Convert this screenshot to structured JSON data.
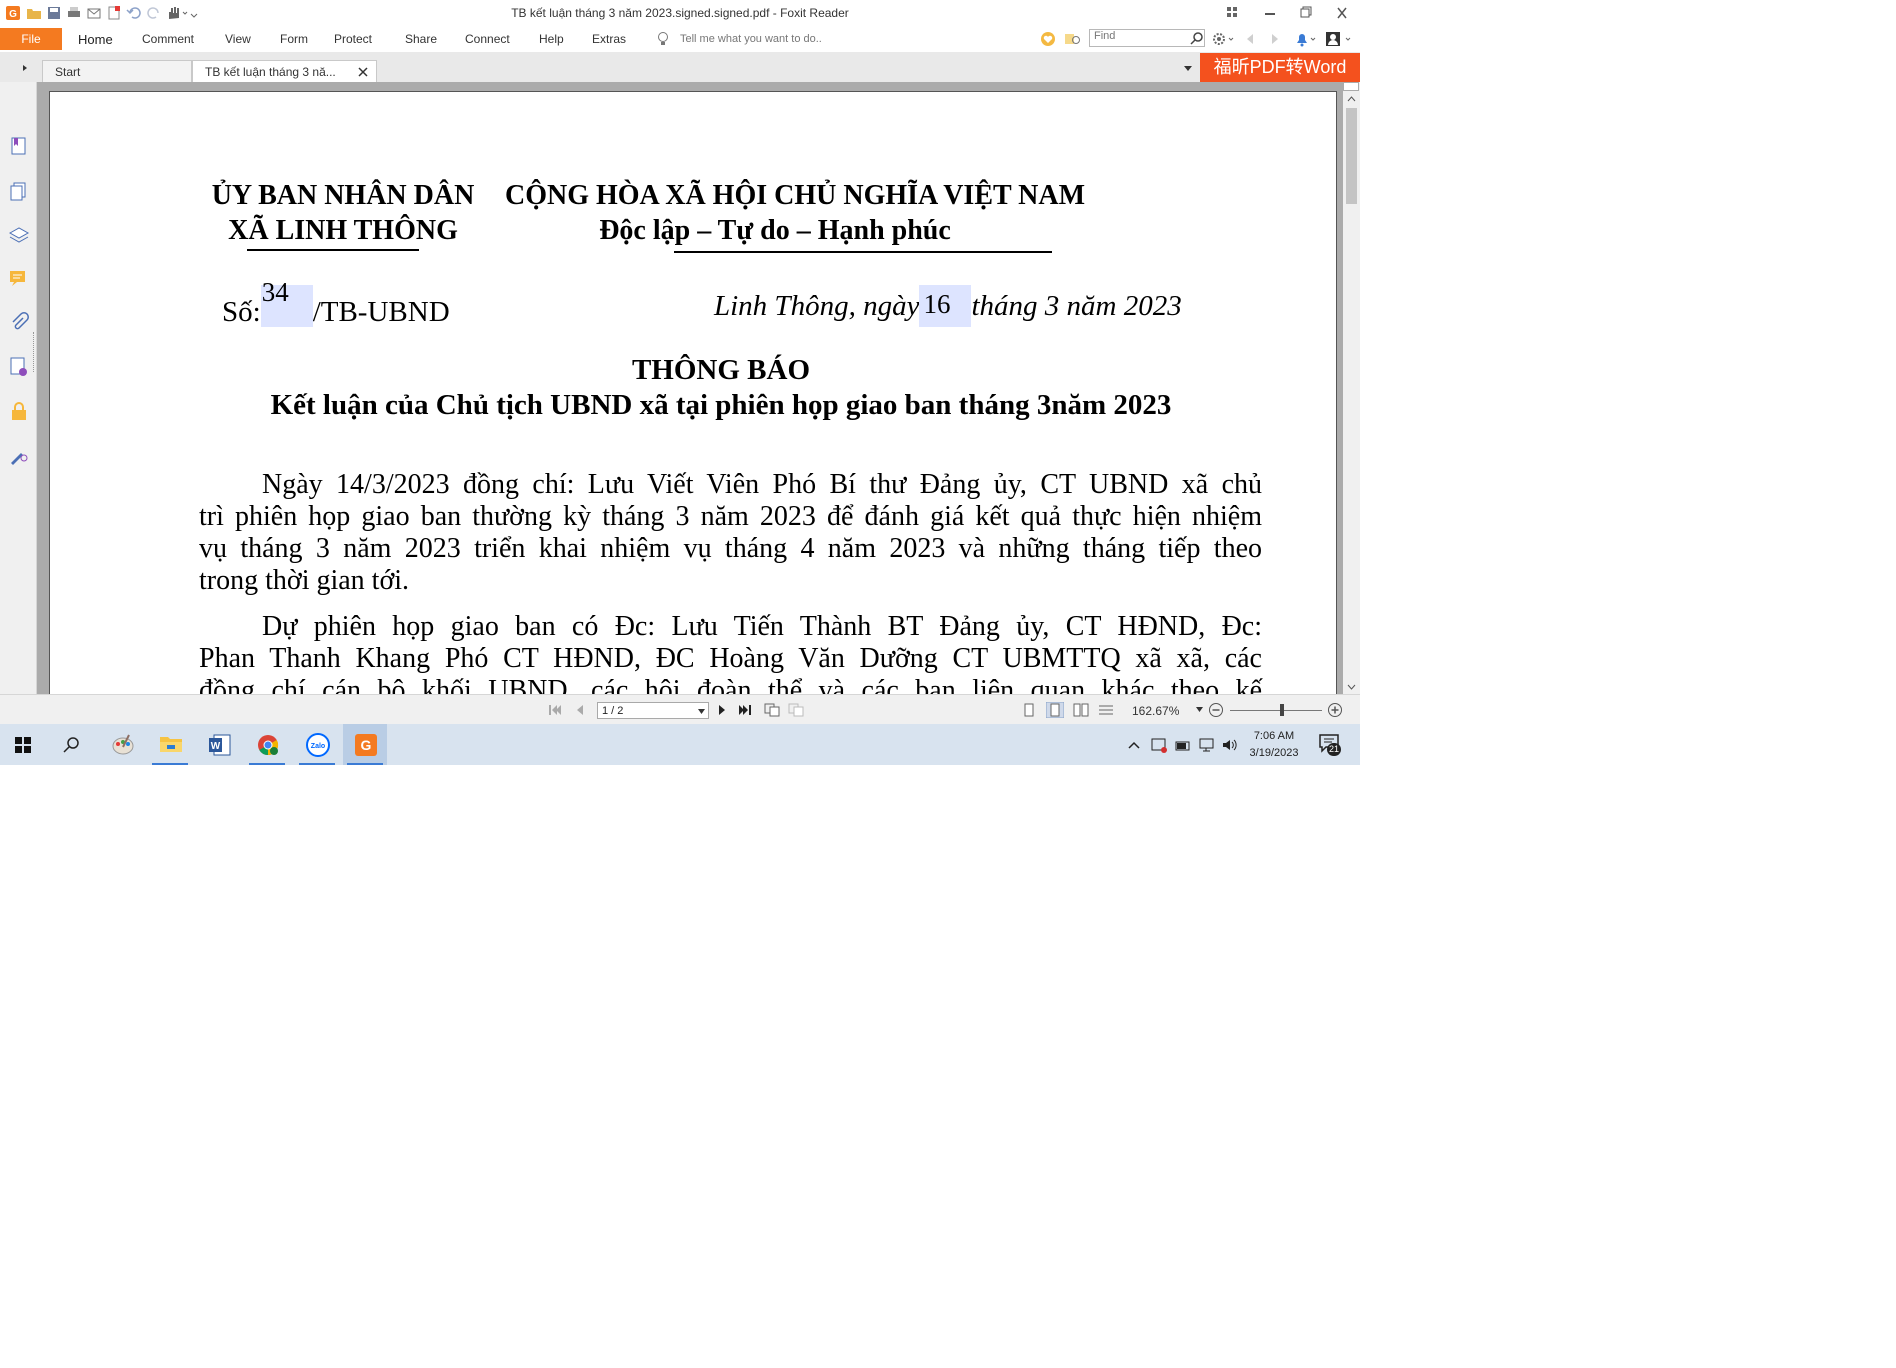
{
  "window": {
    "title": "TB kết luận tháng 3 năm 2023.signed.signed.pdf - Foxit Reader"
  },
  "ribbon": {
    "file": "File",
    "menus": [
      "Home",
      "Comment",
      "View",
      "Form",
      "Protect",
      "Share",
      "Connect",
      "Help",
      "Extras"
    ],
    "tell_me": "Tell me what you want to do..",
    "find_placeholder": "Find"
  },
  "tabs": {
    "start": "Start",
    "doc": "TB kết luận tháng 3 nă...",
    "promo": "福昕PDF转Word"
  },
  "document": {
    "org_line1": "ỦY BAN NHÂN DÂN",
    "org_line2": "XÃ LINH THÔNG",
    "nation_line1": "CỘNG HÒA XÃ HỘI CHỦ NGHĨA VIỆT NAM",
    "nation_line2": "Độc lập – Tự do – Hạnh phúc",
    "number_prefix": "Số:",
    "number_value": "34",
    "number_suffix": "/TB-UBND",
    "date_prefix": "Linh Thông, ngày",
    "date_day": "16",
    "date_suffix": "tháng 3 năm 2023",
    "heading": "THÔNG BÁO",
    "subheading": "Kết luận của Chủ tịch UBND xã tại phiên họp giao ban tháng 3năm 2023",
    "para1": [
      "Ngày 14/3/2023 đồng chí: Lưu Viết Viên Phó Bí thư Đảng ủy, CT UBND xã chủ",
      "trì phiên họp giao ban thường kỳ tháng 3 năm 2023 để đánh giá kết quả thực hiện nhiệm",
      "vụ tháng 3 năm 2023 triển khai nhiệm vụ tháng 4 năm 2023 và những tháng tiếp theo",
      "trong thời gian tới."
    ],
    "para2": [
      "Dự phiên họp giao ban có Đc: Lưu Tiến Thành BT Đảng ủy,  CT HĐND, Đc:",
      "Phan Thanh Khang Phó CT HĐND, ĐC Hoàng Văn Dưỡng CT UBMTTQ xã xã, các",
      "đồng chí cán bộ khối UBND, các hội đoàn thể và các ban liên quan khác theo kế"
    ]
  },
  "status": {
    "page": "1 / 2",
    "zoom": "162.67%"
  },
  "taskbar": {
    "time": "7:06 AM",
    "date": "3/19/2023",
    "notifications": "21"
  },
  "colors": {
    "accent": "#f47a20",
    "promo": "#f4511e",
    "highlight": "#dde4ff"
  },
  "icons": [
    "search-icon",
    "settings-icon",
    "notification-icon",
    "user-icon"
  ]
}
